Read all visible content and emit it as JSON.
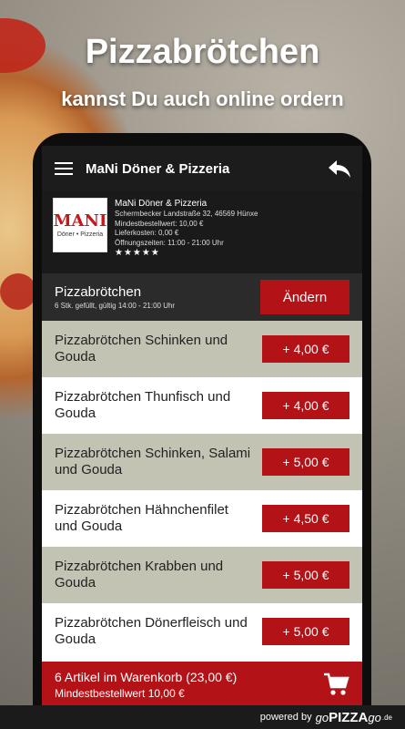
{
  "promo": {
    "headline": "Pizzabrötchen",
    "subline": "kannst Du auch online ordern"
  },
  "appbar": {
    "title": "MaNi Döner & Pizzeria"
  },
  "restaurant": {
    "logo_big": "MANI",
    "logo_small": "Döner • Pizzeria",
    "name": "MaNi Döner & Pizzeria",
    "address": "Schermbecker Landstraße 32, 46569 Hünxe",
    "min_order": "Mindestbestellwert: 10,00 €",
    "delivery": "Lieferkosten: 0,00 €",
    "hours": "Öffnungszeiten: 11:00 - 21:00 Uhr",
    "rating_stars": "★★★★★",
    "rating": 5
  },
  "category": {
    "title": "Pizzabrötchen",
    "subtitle": "6 Stk. gefüllt, gültig 14:00 - 21:00 Uhr",
    "change_label": "Ändern"
  },
  "items": [
    {
      "name": "Pizzabrötchen Schinken und Gouda",
      "price": "+ 4,00 €"
    },
    {
      "name": "Pizzabrötchen Thunfisch und Gouda",
      "price": "+ 4,00 €"
    },
    {
      "name": "Pizzabrötchen Schinken, Salami und Gouda",
      "price": "+ 5,00 €"
    },
    {
      "name": "Pizzabrötchen Hähnchenfilet und Gouda",
      "price": "+ 4,50 €"
    },
    {
      "name": "Pizzabrötchen Krabben und Gouda",
      "price": "+ 5,00 €"
    },
    {
      "name": "Pizzabrötchen Dönerfleisch und Gouda",
      "price": "+ 5,00 €"
    }
  ],
  "cart": {
    "summary": "6 Artikel im Warenkorb (23,00 €)",
    "min_order": "Mindestbestellwert 10,00 €"
  },
  "footer": {
    "powered": "powered by",
    "brand_go": "go",
    "brand_pizza": "PIZZA",
    "brand_go2": "go",
    "tld": ".de"
  },
  "colors": {
    "accent": "#b31217",
    "alt_row": "#c3c3b4"
  }
}
